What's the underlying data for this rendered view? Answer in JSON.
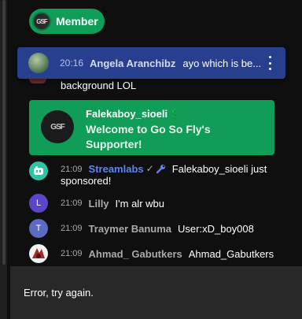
{
  "member_pill": {
    "badge_text": "GSF",
    "label": "Member",
    "color": "#0f9d58"
  },
  "pinned": {
    "time": "20:16",
    "author": "Angela Aranchibz",
    "message": "ayo which is be...",
    "background": "#283f8f"
  },
  "partial_message": "background LOL",
  "membership_card": {
    "avatar_text": "GSF",
    "name": "Falekaboy_sioeli",
    "name_emoji": "💲",
    "welcome": "Welcome to Go So Fly's Supporter!"
  },
  "messages": [
    {
      "avatar": "streamlabs-icon",
      "time": "21:09",
      "author": "Streamlabs",
      "verified": "✓",
      "message_line1": "Falekaboy_sioeli just",
      "message_line2": "sponsored!",
      "author_color": "#5e84f1",
      "avatar_color": "#31c3a2"
    },
    {
      "avatar_letter": "L",
      "avatar_color": "#5c45c7",
      "time": "21:09",
      "author": "Lilly",
      "message": "I'm alr wbu"
    },
    {
      "avatar_letter": "T",
      "avatar_color": "#5c6bc0",
      "time": "21:09",
      "author": "Traymer Banuma",
      "message": "User:xD_boy008"
    },
    {
      "avatar": "anime-avatar",
      "avatar_color": "#a52a2a",
      "time": "21:09",
      "author": "Ahmad_ Gabutkers",
      "message": "Ahmad_Gabutkers"
    }
  ],
  "error": {
    "text": "Error, try again."
  }
}
